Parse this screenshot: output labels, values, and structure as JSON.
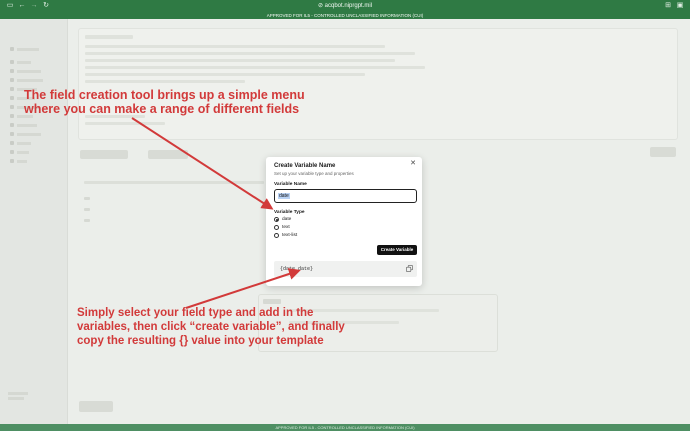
{
  "browser": {
    "url": "acqbot.niprgpt.mil",
    "banner": "APPROVED FOR IL5 - CONTROLLED UNCLASSIFIED INFORMATION (CUI)"
  },
  "modal": {
    "title": "Create Variable Name",
    "subtitle": "Set up your variable type and properties",
    "name_label": "Variable Name",
    "name_value": "date",
    "type_label": "Variable Type",
    "types": [
      "date",
      "text",
      "text-list"
    ],
    "selected_type": "date",
    "create_label": "Create Variable",
    "code_preview": "{date_date}"
  },
  "annotations": {
    "top": "The field creation tool brings up a simple menu\nwhere you can make a range of different fields",
    "bottom": "Simply select your field type and add in the\nvariables, then click “create variable”, and finally\ncopy the resulting {} value into your template",
    "color": "#d23a3a"
  },
  "icons": {
    "sidebar_toggle": "sidebar-toggle-icon",
    "back": "back-arrow-icon",
    "forward": "forward-arrow-icon",
    "reload": "reload-icon",
    "lock": "lock-icon",
    "close": "close-icon",
    "copy": "copy-icon"
  }
}
